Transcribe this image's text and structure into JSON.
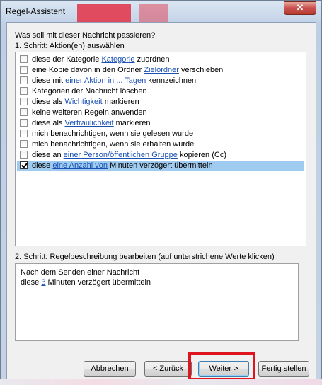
{
  "window": {
    "title": "Regel-Assistent",
    "close_symbol": "✕"
  },
  "prompt": "Was soll mit dieser Nachricht passieren?",
  "step1": {
    "label": "1. Schritt: Aktion(en) auswählen",
    "actions": [
      {
        "checked": false,
        "pre": "diese der Kategorie ",
        "link": "Kategorie",
        "post": " zuordnen"
      },
      {
        "checked": false,
        "pre": "eine Kopie davon in den Ordner ",
        "link": "Zielordner",
        "post": " verschieben"
      },
      {
        "checked": false,
        "pre": "diese mit ",
        "link": "einer Aktion in ... Tagen",
        "post": " kennzeichnen"
      },
      {
        "checked": false,
        "pre": "Kategorien der Nachricht löschen",
        "link": "",
        "post": ""
      },
      {
        "checked": false,
        "pre": "diese als ",
        "link": "Wichtigkeit",
        "post": " markieren"
      },
      {
        "checked": false,
        "pre": "keine weiteren Regeln anwenden",
        "link": "",
        "post": ""
      },
      {
        "checked": false,
        "pre": "diese als ",
        "link": "Vertraulichkeit",
        "post": " markieren"
      },
      {
        "checked": false,
        "pre": "mich benachrichtigen, wenn sie gelesen wurde",
        "link": "",
        "post": ""
      },
      {
        "checked": false,
        "pre": "mich benachrichtigen, wenn sie erhalten wurde",
        "link": "",
        "post": ""
      },
      {
        "checked": false,
        "pre": "diese an ",
        "link": "einer Person/öffentlichen Gruppe",
        "post": " kopieren (Cc)"
      },
      {
        "checked": true,
        "pre": "diese ",
        "link": "eine Anzahl von",
        "post": " Minuten verzögert übermitteln"
      }
    ]
  },
  "step2": {
    "label": "2. Schritt: Regelbeschreibung bearbeiten (auf unterstrichene Werte klicken)",
    "line1": "Nach dem Senden einer Nachricht",
    "line2_pre": "diese ",
    "line2_link": "3",
    "line2_post": " Minuten verzögert übermitteln"
  },
  "buttons": {
    "cancel": "Abbrechen",
    "back": "< Zurück",
    "next": "Weiter >",
    "finish": "Fertig stellen"
  },
  "colors": {
    "selection": "#9fcbf0",
    "link": "#1a50b4",
    "highlight_box": "#e0141e"
  }
}
